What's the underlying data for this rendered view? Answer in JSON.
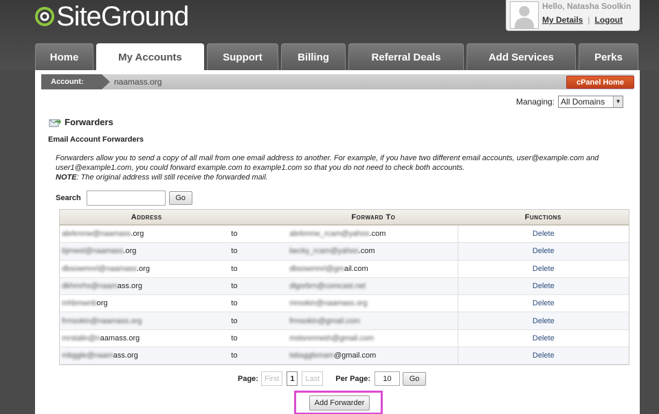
{
  "header": {
    "logo_text": "SiteGround",
    "user": {
      "greeting": "Hello, Natasha Soolkin",
      "my_details": "My Details",
      "separator": "|",
      "logout": "Logout"
    }
  },
  "tabs": [
    {
      "label": "Home",
      "active": false
    },
    {
      "label": "My Accounts",
      "active": true
    },
    {
      "label": "Support",
      "active": false
    },
    {
      "label": "Billing",
      "active": false
    },
    {
      "label": "Referral Deals",
      "active": false
    },
    {
      "label": "Add Services",
      "active": false
    },
    {
      "label": "Perks",
      "active": false
    }
  ],
  "account": {
    "label": "Account:",
    "name": "naamass.org",
    "cpanel_button": "cPanel Home"
  },
  "managing": {
    "label": "Managing:",
    "selected": "All Domains"
  },
  "forwarders": {
    "title": "Forwarders",
    "section_title": "Email Account Forwarders",
    "description_1": "Forwarders allow you to send a copy of all mail from one email address to another. For example, if you have two different email accounts, user@example.com and user1@example1.com, you could forward example.com to example1.com so that you do not need to check both accounts.",
    "note_label": "NOTE",
    "note_text": ": The original address will still receive the forwarded mail."
  },
  "search": {
    "label": "Search",
    "value": "",
    "go": "Go"
  },
  "table": {
    "headers": {
      "address": "Address",
      "forward_to": "Forward To",
      "functions": "Functions"
    },
    "rows": [
      {
        "addr_hidden": "abrkmnw@naamass",
        "addr_visible": ".org",
        "to": "to",
        "fwd_hidden": "abrkmnw_rcam@yahoo",
        "fwd_visible": ".com",
        "action": "Delete"
      },
      {
        "addr_hidden": "bjmwsl@naamass",
        "addr_visible": ".org",
        "to": "to",
        "fwd_hidden": "becky_rcam@yahoo",
        "fwd_visible": ".com",
        "action": "Delete"
      },
      {
        "addr_hidden": "dbsowmnrl@naamass",
        "addr_visible": ".org",
        "to": "to",
        "fwd_hidden": "dbsowmnrl@gm",
        "fwd_visible": "ail.com",
        "action": "Delete"
      },
      {
        "addr_hidden": "dkhmrhs@naam",
        "addr_visible": "ass.org",
        "to": "to",
        "fwd_hidden": "dlgorbrn@comcast.net",
        "fwd_visible": "",
        "action": "Delete"
      },
      {
        "addr_hidden": "mhbmwnb",
        "addr_visible": "org",
        "to": "to",
        "fwd_hidden": "mrsokin@naamass.org",
        "fwd_visible": "",
        "action": "Delete"
      },
      {
        "addr_hidden": "frmsokin@naamass.org",
        "addr_visible": "",
        "to": "to",
        "fwd_hidden": "frmsokin@gmail.com",
        "fwd_visible": "",
        "action": "Delete"
      },
      {
        "addr_hidden": "mrstalin@n",
        "addr_visible": "aamass.org",
        "to": "to",
        "fwd_hidden": "mstsnmrwsh@gmail.com",
        "fwd_visible": "",
        "action": "Delete"
      },
      {
        "addr_hidden": "mbggle@naam",
        "addr_visible": "ass.org",
        "to": "to",
        "fwd_hidden": "tsbsgglsmam",
        "fwd_visible": "@gmail.com",
        "action": "Delete"
      }
    ]
  },
  "pager": {
    "page_label": "Page:",
    "first": "First",
    "current": "1",
    "last": "Last",
    "per_page_label": "Per Page:",
    "per_page_value": "10",
    "go": "Go"
  },
  "add_forwarder": "Add Forwarder",
  "colors": {
    "accent_highlight": "#d94bd0",
    "cpanel_orange": "#d0502a",
    "logo_green": "#8dc63f"
  }
}
